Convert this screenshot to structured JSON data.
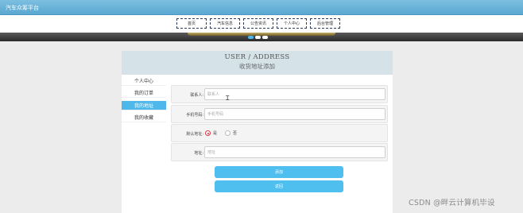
{
  "header": {
    "site_title": "汽车众筹平台"
  },
  "nav": {
    "items": [
      {
        "label": "首页"
      },
      {
        "label": "汽车信息"
      },
      {
        "label": "公告资讯"
      },
      {
        "label": "个人中心"
      },
      {
        "label": "后台管理"
      }
    ]
  },
  "banner": {
    "slide_count": 3,
    "active_slide": 1
  },
  "page": {
    "title_en": "USER / ADDRESS",
    "title_cn": "收货地址添加"
  },
  "sidebar": {
    "items": [
      {
        "label": "个人中心"
      },
      {
        "label": "我的订单"
      },
      {
        "label": "我的地址"
      },
      {
        "label": "我的收藏"
      }
    ],
    "active_index": 2
  },
  "form": {
    "consignee": {
      "label": "联系人:",
      "placeholder": "联系人"
    },
    "phone": {
      "label": "手机号码:",
      "placeholder": "手机号码"
    },
    "default": {
      "label": "默认地址:",
      "options": [
        {
          "label": "是"
        },
        {
          "label": "否"
        }
      ],
      "selected": "是"
    },
    "address": {
      "label": "地址:",
      "placeholder": "地址"
    },
    "submit_label": "添加",
    "back_label": "返回"
  },
  "watermark": {
    "text": "CSDN @畔云计算机毕设"
  }
}
